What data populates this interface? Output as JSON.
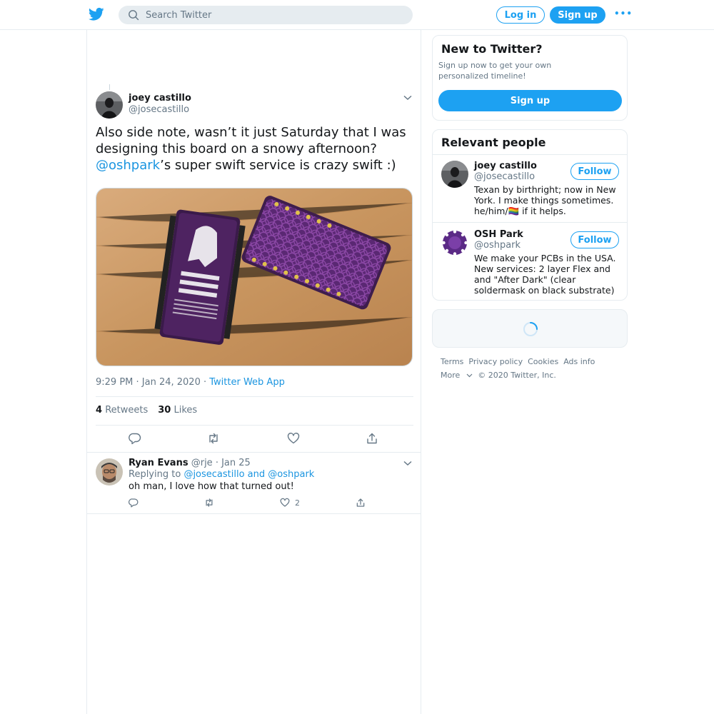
{
  "header": {
    "search_placeholder": "Search Twitter",
    "login_label": "Log in",
    "signup_label": "Sign up",
    "more_icon": "more-dots-icon"
  },
  "tweet": {
    "author_name": "joey castillo",
    "author_handle": "@josecastillo",
    "text_before": "Also side note, wasn’t it just Saturday that I was designing this board on a snowy afternoon? ",
    "mention": "@oshpark",
    "text_after": "’s super swift service is crazy swift :)",
    "time": "9:29 PM · Jan 24, 2020 · ",
    "source": "Twitter Web App",
    "retweets_count": "4",
    "retweets_label": "Retweets",
    "likes_count": "30",
    "likes_label": "Likes"
  },
  "reply": {
    "name": "Ryan Evans",
    "handle": "@rje",
    "date": " · Jan 25",
    "replying_prefix": "Replying to ",
    "replying_user1": "@josecastillo",
    "replying_and": " and ",
    "replying_user2": "@oshpark",
    "text": "oh man, I love how that turned out!",
    "like_count": "2"
  },
  "sidebar": {
    "new_title": "New to Twitter?",
    "new_desc": "Sign up now to get your own personalized timeline!",
    "new_signup_label": "Sign up",
    "people_title": "Relevant people",
    "people": [
      {
        "name": "joey castillo",
        "handle": "@josecastillo",
        "bio": "Texan by birthright; now in New York. I make things sometimes. he/him/🏳️‍🌈 if it helps.",
        "follow_label": "Follow"
      },
      {
        "name": "OSH Park",
        "handle": "@oshpark",
        "bio": "We make your PCBs in the USA. New services: 2 layer Flex and and \"After Dark\" (clear soldermask on black substrate)",
        "follow_label": "Follow"
      }
    ]
  },
  "footer": {
    "links": [
      "Terms",
      "Privacy policy",
      "Cookies",
      "Ads info"
    ],
    "more": "More",
    "copyright": "© 2020 Twitter, Inc."
  },
  "colors": {
    "accent": "#1da1f2",
    "link": "#1b95e0",
    "muted": "#657786",
    "border": "#e6ecf0"
  }
}
